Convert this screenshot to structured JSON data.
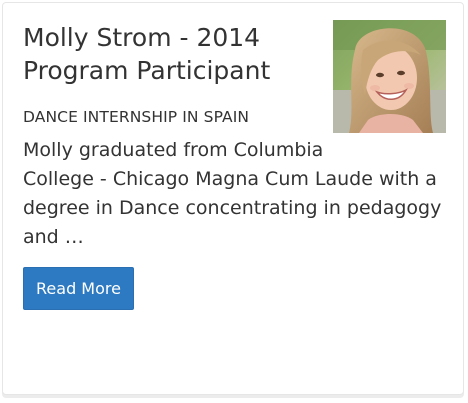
{
  "card": {
    "title_line1": "Molly Strom - 2014",
    "title_line2": "Program Participant",
    "subtitle": "DANCE INTERNSHIP IN SPAIN",
    "excerpt_lines": [
      "Molly graduated from Columbia",
      "College - Chicago Magna Cum Laude with a",
      "degree in Dance concentrating in pedagogy",
      "and …"
    ],
    "button_label": "Read More",
    "photo_icon": "profile-photo",
    "colors": {
      "button": "#2e7ac2",
      "text": "#333333",
      "border": "#e6e6e6"
    }
  }
}
